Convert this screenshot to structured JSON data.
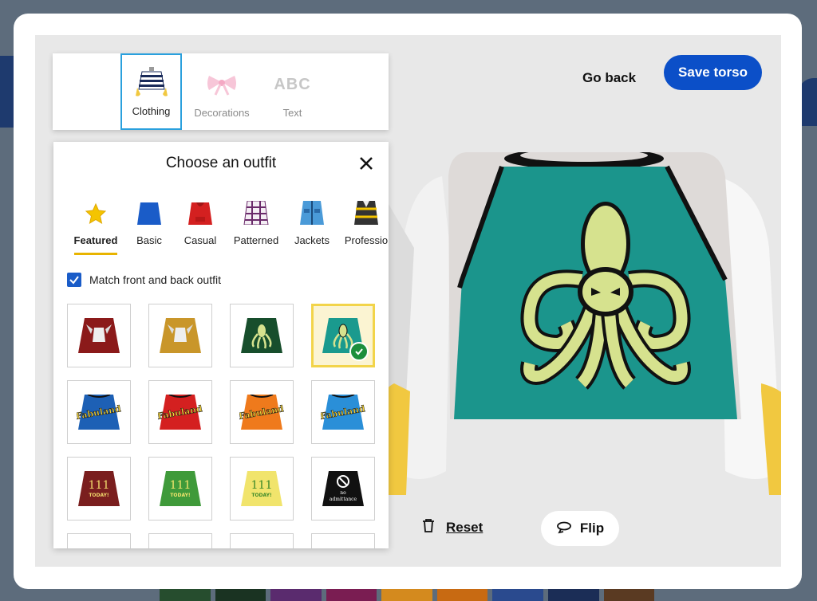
{
  "tabs": [
    {
      "label": "Clothing",
      "icon": "striped-shirt-icon",
      "active": true
    },
    {
      "label": "Decorations",
      "icon": "bow-icon",
      "active": false
    },
    {
      "label": "Text",
      "icon": "abc-icon",
      "glyph": "ABC",
      "active": false
    }
  ],
  "header": {
    "go_back": "Go back",
    "save": "Save torso"
  },
  "panel": {
    "title": "Choose an outfit",
    "categories": [
      {
        "label": "Featured",
        "icon": "star-icon",
        "active": true
      },
      {
        "label": "Basic",
        "icon": "plain-shirt-icon"
      },
      {
        "label": "Casual",
        "icon": "hoodie-icon"
      },
      {
        "label": "Patterned",
        "icon": "plaid-shirt-icon"
      },
      {
        "label": "Jackets",
        "icon": "jacket-icon"
      },
      {
        "label": "Professio",
        "icon": "vest-icon"
      }
    ],
    "match_label": "Match front and back outfit",
    "match_checked": true,
    "outfits": [
      {
        "name": "dark-red-griffin",
        "color": "#8b1a1a",
        "selected": false
      },
      {
        "name": "mustard-griffin",
        "color": "#c9962a",
        "selected": false
      },
      {
        "name": "green-octopus",
        "color": "#174e2c",
        "selected": false
      },
      {
        "name": "teal-octopus",
        "color": "#1a9a8e",
        "selected": true
      },
      {
        "name": "blue-fabuland",
        "color": "#1d60b5",
        "text": "Fabuland",
        "selected": false
      },
      {
        "name": "red-fabuland",
        "color": "#d42020",
        "text": "Fabuland",
        "selected": false
      },
      {
        "name": "orange-fabuland",
        "color": "#ef7a1c",
        "text": "Fabuland",
        "selected": false
      },
      {
        "name": "light-blue-fabuland",
        "color": "#2a8fd8",
        "text": "Fabuland",
        "selected": false
      },
      {
        "name": "maroon-111",
        "color": "#7a1e1e",
        "text": "111",
        "sub": "TODAY!",
        "selected": false
      },
      {
        "name": "green-111",
        "color": "#3f9a3a",
        "text": "111",
        "sub": "TODAY!",
        "selected": false
      },
      {
        "name": "yellow-111",
        "color": "#f1e46c",
        "text": "111",
        "sub": "TODAY!",
        "selected": false
      },
      {
        "name": "black-no-admittance",
        "color": "#111111",
        "text": "no",
        "sub": "admittance",
        "selected": false
      }
    ]
  },
  "footer": {
    "reset": "Reset",
    "flip": "Flip"
  },
  "colors": {
    "accent": "#0b4fc8",
    "active_tab_border": "#2aa0dd",
    "category_underline": "#e8b400",
    "selected_tile_border": "#f2d44a",
    "torso_teal": "#1a9a8e",
    "octopus": "#d6e28e"
  }
}
